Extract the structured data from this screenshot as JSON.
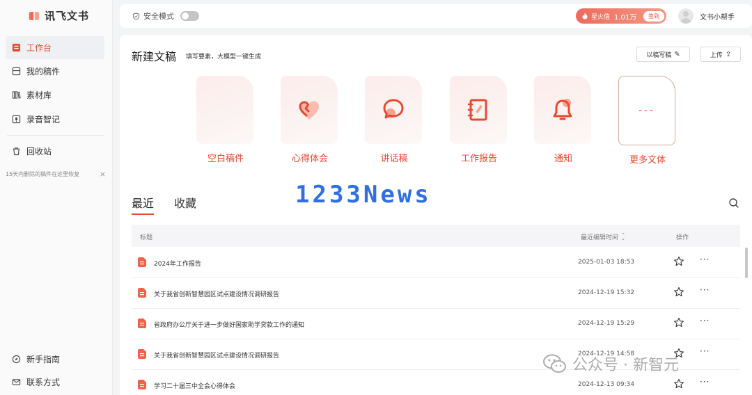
{
  "app": {
    "name": "讯飞文书"
  },
  "sidebar": {
    "items": [
      {
        "label": "工作台",
        "icon": "workbench-icon",
        "active": true
      },
      {
        "label": "我的稿件",
        "icon": "drafts-icon"
      },
      {
        "label": "素材库",
        "icon": "library-icon"
      },
      {
        "label": "录音智记",
        "icon": "recording-icon"
      },
      {
        "label": "回收站",
        "icon": "trash-icon"
      }
    ],
    "trash_hint": "15天内删除的稿件在这里恢复",
    "bottom": [
      {
        "label": "新手指南",
        "icon": "compass-icon"
      },
      {
        "label": "联系方式",
        "icon": "mail-icon"
      }
    ]
  },
  "topbar": {
    "safe_mode_label": "安全模式",
    "coin_label": "星火值",
    "coin_value": "1.01万",
    "sign_label": "签到",
    "user_name": "文书小帮手"
  },
  "new_doc": {
    "title": "新建文稿",
    "subtitle": "填写要素，大模型一键生成",
    "buttons": {
      "write_by_draft": "以稿写稿",
      "upload": "上传"
    },
    "templates": [
      {
        "label": "空白稿件",
        "icon": "blank-doc-icon"
      },
      {
        "label": "心得体会",
        "icon": "heart-icon"
      },
      {
        "label": "讲话稿",
        "icon": "speech-bubble-icon"
      },
      {
        "label": "工作报告",
        "icon": "report-book-icon"
      },
      {
        "label": "通知",
        "icon": "bell-icon"
      },
      {
        "label": "更多文体",
        "icon": "more-dashes-icon"
      }
    ]
  },
  "tabs": {
    "recent": "最近",
    "favorites": "收藏"
  },
  "overlay_logo": "1233News",
  "table": {
    "headers": {
      "title": "标题",
      "edited": "最近编辑时间",
      "actions": "操作"
    },
    "rows": [
      {
        "name": "2024年工作报告",
        "time": "2025-01-03 18:53"
      },
      {
        "name": "关于我省创新智慧园区试点建设情况调研报告",
        "time": "2024-12-19 15:32"
      },
      {
        "name": "省政府办公厅关于进一步做好国家助学贷款工作的通知",
        "time": "2024-12-19 15:29"
      },
      {
        "name": "关于我省创新智慧园区试点建设情况调研报告",
        "time": "2024-12-19 14:58"
      },
      {
        "name": "学习二十届三中全会心得体会",
        "time": "2024-12-13 09:34"
      }
    ],
    "more_label": "···"
  },
  "watermark": {
    "text": "公众号 · 新智元"
  },
  "colors": {
    "accent": "#e8492f",
    "logo_blue": "#2f6fe6"
  }
}
